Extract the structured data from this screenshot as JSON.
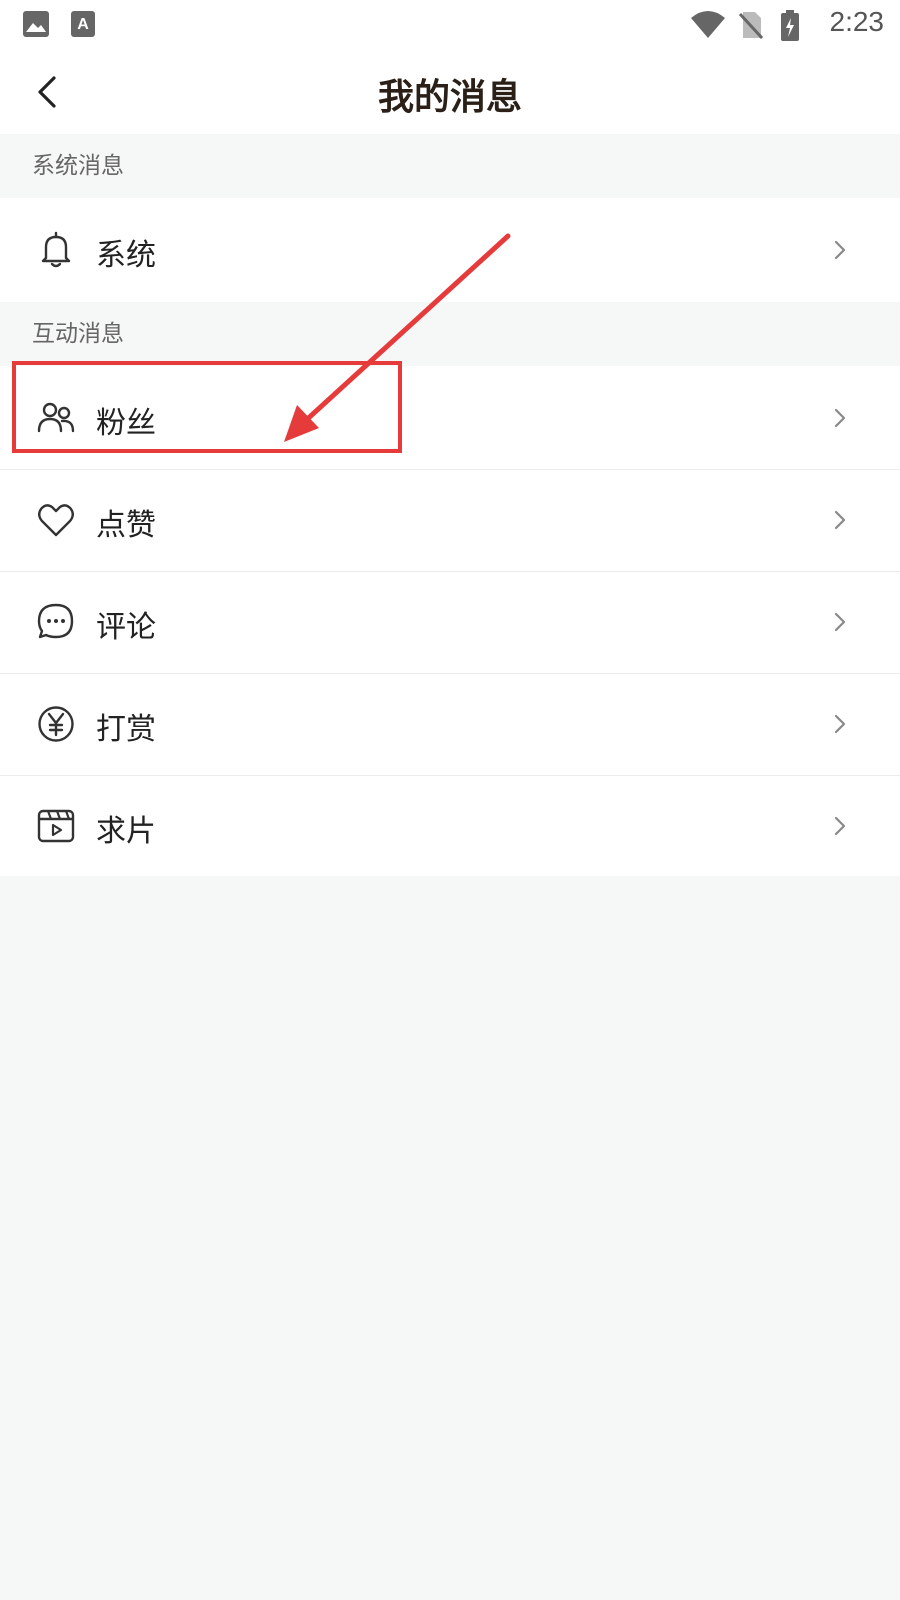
{
  "status_bar": {
    "time": "2:23",
    "icons": [
      "image-icon",
      "a-text-icon",
      "wifi-icon",
      "no-sim-icon",
      "battery-charging-icon"
    ]
  },
  "header": {
    "title": "我的消息",
    "back_icon": "chevron-left-icon"
  },
  "sections": [
    {
      "label": "系统消息",
      "items": [
        {
          "label": "系统",
          "icon": "bell-icon"
        }
      ]
    },
    {
      "label": "互动消息",
      "items": [
        {
          "label": "粉丝",
          "icon": "users-icon"
        },
        {
          "label": "点赞",
          "icon": "heart-icon"
        },
        {
          "label": "评论",
          "icon": "comment-dots-icon"
        },
        {
          "label": "打赏",
          "icon": "yen-coin-icon"
        },
        {
          "label": "求片",
          "icon": "video-clapper-icon"
        }
      ]
    }
  ],
  "colors": {
    "background": "#f6f7f7",
    "surface": "#ffffff",
    "title": "#2a2017",
    "section_text": "#666666",
    "annotation": "#e53b3b"
  }
}
